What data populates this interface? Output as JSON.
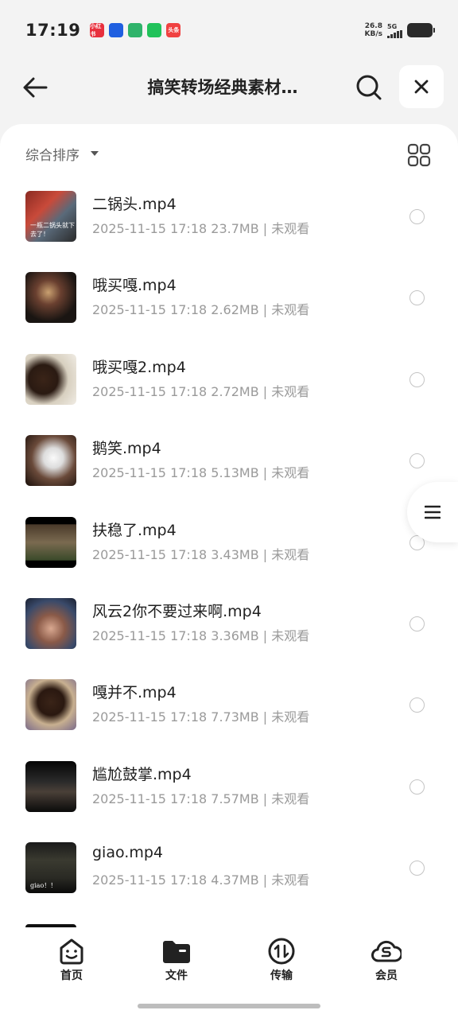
{
  "status_bar": {
    "time": "17:19",
    "apps": [
      {
        "icon": "xiaohongshu-icon",
        "color": "#e8303d",
        "text": "小红书"
      },
      {
        "icon": "app-blue-icon",
        "color": "#1f5fe0",
        "text": ""
      },
      {
        "icon": "recycle-green-icon",
        "color": "#2fb36a",
        "text": ""
      },
      {
        "icon": "wechat-icon",
        "color": "#21c25a",
        "text": ""
      },
      {
        "icon": "toutiao-icon",
        "color": "#f04141",
        "text": "头条"
      }
    ],
    "net_speed_value": "26.8",
    "net_speed_unit": "KB/s",
    "signal_label": "5G"
  },
  "header": {
    "title": "搞笑转场经典素材…"
  },
  "toolbar": {
    "sort_label": "综合排序"
  },
  "files": [
    {
      "name": "二锅头.mp4",
      "meta": "2025-11-15 17:18  23.7MB | 未观看",
      "thumb_bg": "linear-gradient(135deg,#8a2a22 0%,#c94a3a 35%,#5a6a7a 60%,#2a2a2a 100%)",
      "thumb_caption": "一瓶二锅头就下去了！"
    },
    {
      "name": "哦买嘎.mp4",
      "meta": "2025-11-15 17:18  2.62MB | 未观看",
      "thumb_bg": "radial-gradient(circle at 45% 40%,#c9a070 0%,#6a4030 30%,#1a1512 70%)",
      "thumb_caption": ""
    },
    {
      "name": "哦买嘎2.mp4",
      "meta": "2025-11-15 17:18  2.72MB | 未观看",
      "thumb_bg": "radial-gradient(circle at 35% 50%,#3a2418 0%,#2a1a12 35%,#d8d0c0 60%,#f0ece4 100%)",
      "thumb_caption": ""
    },
    {
      "name": "鹅笑.mp4",
      "meta": "2025-11-15 17:18  5.13MB | 未观看",
      "thumb_bg": "radial-gradient(circle at 55% 45%,#fafafa 0%,#ddd 25%,#6a4a3a 55%,#1a0f0a 100%)",
      "thumb_caption": ""
    },
    {
      "name": "扶稳了.mp4",
      "meta": "2025-11-15 17:18  3.43MB | 未观看",
      "thumb_bg": "linear-gradient(180deg,#000 0%,#000 14%,#4a3a2a 15%,#7a6a50 50%,#3a4a2a 85%,#000 86%,#000 100%)",
      "thumb_caption": ""
    },
    {
      "name": "风云2你不要过来啊.mp4",
      "meta": "2025-11-15 17:18  3.36MB | 未观看",
      "thumb_bg": "radial-gradient(circle at 50% 60%,#d9a890 0%,#8a5a48 35%,#3a4a6a 70%,#1a2030 100%)",
      "thumb_caption": ""
    },
    {
      "name": "嘎并不.mp4",
      "meta": "2025-11-15 17:18  7.73MB | 未观看",
      "thumb_bg": "radial-gradient(circle at 50% 45%,#3a2418 0%,#2a1810 35%,#c8b090 60%,#7a6a8a 100%)",
      "thumb_caption": ""
    },
    {
      "name": "尴尬鼓掌.mp4",
      "meta": "2025-11-15 17:18  7.57MB | 未观看",
      "thumb_bg": "linear-gradient(180deg,#050505 0%,#2a2a2a 40%,#4a4038 60%,#0a0a0a 100%)",
      "thumb_caption": ""
    },
    {
      "name": "giao.mp4",
      "meta": "2025-11-15 17:18  4.37MB | 未观看",
      "thumb_bg": "linear-gradient(180deg,#1a1a1a 0%,#3a3a30 35%,#2a2a24 70%,#0a0a0a 100%)",
      "thumb_caption": "giao！！"
    }
  ],
  "tabs": [
    {
      "label": "首页",
      "icon": "home-smile-icon"
    },
    {
      "label": "文件",
      "icon": "folder-icon"
    },
    {
      "label": "传输",
      "icon": "transfer-icon"
    },
    {
      "label": "会员",
      "icon": "vip-cloud-icon"
    }
  ]
}
